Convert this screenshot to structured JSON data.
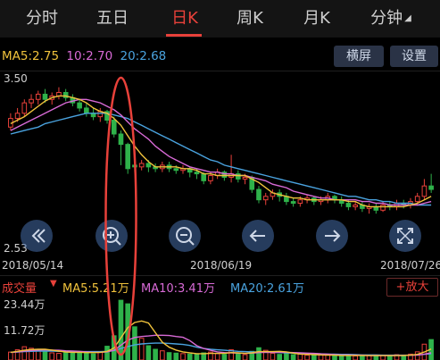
{
  "tabs": [
    {
      "label": "分时"
    },
    {
      "label": "五日"
    },
    {
      "label": "日K"
    },
    {
      "label": "周K"
    },
    {
      "label": "月K"
    },
    {
      "label": "分钟"
    }
  ],
  "active_tab": "日K",
  "ma": {
    "ma5": "MA5:2.75",
    "ma10": "10:2.70",
    "ma20": "20:2.68"
  },
  "buttons": {
    "landscape": "横屏",
    "settings": "设置"
  },
  "price_axis": {
    "max": "3.50",
    "min": "2.53"
  },
  "dates": {
    "start": "2018/05/14",
    "mid": "2018/06/19",
    "end": "2018/07/26"
  },
  "volume": {
    "label": "成交量",
    "ma5": "MA5:5.21万",
    "ma10": "MA10:3.41万",
    "ma20": "MA20:2.61万",
    "add_indicator": "+放大",
    "axis_max": "23.44万",
    "axis_mid": "11.72万"
  },
  "colors": {
    "up": "#e8413a",
    "down": "#2fb24a",
    "ma5": "#f0c23c",
    "ma10": "#d86ad6",
    "ma20": "#4aa3df",
    "highlight": "#e8413a",
    "button_bg": "#2a3346"
  },
  "icons": [
    "rewind-icon",
    "zoom-in-icon",
    "zoom-out-icon",
    "arrow-left-icon",
    "arrow-right-icon",
    "fullscreen-icon"
  ],
  "chart_data": {
    "type": "candlestick",
    "ylim": [
      2.53,
      3.5
    ],
    "candles": [
      [
        3.22,
        3.27,
        3.2,
        3.3
      ],
      [
        3.27,
        3.3,
        3.25,
        3.33
      ],
      [
        3.3,
        3.36,
        3.28,
        3.38
      ],
      [
        3.36,
        3.38,
        3.33,
        3.41
      ],
      [
        3.38,
        3.41,
        3.35,
        3.43
      ],
      [
        3.41,
        3.38,
        3.36,
        3.44
      ],
      [
        3.38,
        3.4,
        3.35,
        3.42
      ],
      [
        3.4,
        3.42,
        3.38,
        3.45
      ],
      [
        3.42,
        3.39,
        3.37,
        3.44
      ],
      [
        3.39,
        3.36,
        3.34,
        3.41
      ],
      [
        3.36,
        3.33,
        3.31,
        3.38
      ],
      [
        3.33,
        3.3,
        3.28,
        3.36
      ],
      [
        3.3,
        3.28,
        3.26,
        3.33
      ],
      [
        3.28,
        3.31,
        3.25,
        3.33
      ],
      [
        3.31,
        3.26,
        3.24,
        3.32
      ],
      [
        3.26,
        3.18,
        3.16,
        3.28
      ],
      [
        3.18,
        3.12,
        3.0,
        3.2
      ],
      [
        3.12,
        2.98,
        2.95,
        3.13
      ],
      [
        3.0,
        2.99,
        2.96,
        3.05
      ],
      [
        2.99,
        3.01,
        2.97,
        3.03
      ],
      [
        3.01,
        2.99,
        2.96,
        3.03
      ],
      [
        2.99,
        2.98,
        2.96,
        3.01
      ],
      [
        2.98,
        3.0,
        2.96,
        3.02
      ],
      [
        3.0,
        2.98,
        2.96,
        3.02
      ],
      [
        2.98,
        2.97,
        2.95,
        3.0
      ],
      [
        2.97,
        2.98,
        2.95,
        3.0
      ],
      [
        2.98,
        2.96,
        2.93,
        2.99
      ],
      [
        2.96,
        2.95,
        2.92,
        2.98
      ],
      [
        2.95,
        2.91,
        2.89,
        2.96
      ],
      [
        2.91,
        2.94,
        2.89,
        2.96
      ],
      [
        2.94,
        2.96,
        2.92,
        2.98
      ],
      [
        2.96,
        2.93,
        2.91,
        2.97
      ],
      [
        2.93,
        2.95,
        2.9,
        3.06
      ],
      [
        2.95,
        2.92,
        2.9,
        2.97
      ],
      [
        2.92,
        2.93,
        2.89,
        2.95
      ],
      [
        2.93,
        2.86,
        2.84,
        2.94
      ],
      [
        2.86,
        2.8,
        2.78,
        2.88
      ],
      [
        2.8,
        2.82,
        2.77,
        2.84
      ],
      [
        2.82,
        2.84,
        2.8,
        2.86
      ],
      [
        2.84,
        2.82,
        2.79,
        2.86
      ],
      [
        2.82,
        2.79,
        2.77,
        2.84
      ],
      [
        2.79,
        2.78,
        2.76,
        2.81
      ],
      [
        2.78,
        2.8,
        2.76,
        2.82
      ],
      [
        2.8,
        2.81,
        2.78,
        2.83
      ],
      [
        2.81,
        2.79,
        2.77,
        2.82
      ],
      [
        2.79,
        2.8,
        2.77,
        2.82
      ],
      [
        2.8,
        2.82,
        2.78,
        2.84
      ],
      [
        2.82,
        2.8,
        2.78,
        2.83
      ],
      [
        2.8,
        2.78,
        2.76,
        2.82
      ],
      [
        2.78,
        2.76,
        2.74,
        2.8
      ],
      [
        2.76,
        2.77,
        2.74,
        2.79
      ],
      [
        2.77,
        2.75,
        2.73,
        2.79
      ],
      [
        2.75,
        2.76,
        2.72,
        2.78
      ],
      [
        2.76,
        2.74,
        2.72,
        2.78
      ],
      [
        2.74,
        2.77,
        2.73,
        2.79
      ],
      [
        2.77,
        2.76,
        2.74,
        2.79
      ],
      [
        2.76,
        2.78,
        2.74,
        2.8
      ],
      [
        2.78,
        2.77,
        2.75,
        2.8
      ],
      [
        2.77,
        2.79,
        2.75,
        2.81
      ],
      [
        2.79,
        2.82,
        2.77,
        2.84
      ],
      [
        2.82,
        2.88,
        2.8,
        2.92
      ],
      [
        2.88,
        2.86,
        2.84,
        2.95
      ]
    ],
    "ma5": [
      3.24,
      3.26,
      3.28,
      3.31,
      3.34,
      3.37,
      3.39,
      3.4,
      3.4,
      3.39,
      3.38,
      3.36,
      3.33,
      3.31,
      3.3,
      3.27,
      3.23,
      3.17,
      3.11,
      3.06,
      3.02,
      2.99,
      2.99,
      2.99,
      2.99,
      2.98,
      2.98,
      2.97,
      2.95,
      2.95,
      2.94,
      2.94,
      2.94,
      2.94,
      2.94,
      2.92,
      2.9,
      2.87,
      2.84,
      2.83,
      2.82,
      2.81,
      2.81,
      2.8,
      2.8,
      2.8,
      2.8,
      2.8,
      2.8,
      2.79,
      2.79,
      2.77,
      2.76,
      2.76,
      2.76,
      2.76,
      2.76,
      2.76,
      2.77,
      2.78,
      2.8,
      2.82
    ],
    "ma10": [
      3.2,
      3.22,
      3.24,
      3.26,
      3.28,
      3.3,
      3.32,
      3.34,
      3.36,
      3.37,
      3.38,
      3.38,
      3.37,
      3.36,
      3.34,
      3.32,
      3.29,
      3.25,
      3.21,
      3.18,
      3.15,
      3.11,
      3.08,
      3.05,
      3.03,
      3.01,
      2.99,
      2.98,
      2.97,
      2.96,
      2.96,
      2.95,
      2.95,
      2.94,
      2.94,
      2.93,
      2.92,
      2.91,
      2.89,
      2.88,
      2.87,
      2.85,
      2.84,
      2.83,
      2.82,
      2.81,
      2.81,
      2.8,
      2.8,
      2.8,
      2.8,
      2.79,
      2.79,
      2.78,
      2.78,
      2.77,
      2.77,
      2.77,
      2.77,
      2.77,
      2.78,
      2.79
    ],
    "ma20": [
      3.18,
      3.19,
      3.2,
      3.21,
      3.22,
      3.24,
      3.25,
      3.26,
      3.27,
      3.28,
      3.29,
      3.3,
      3.3,
      3.3,
      3.3,
      3.29,
      3.28,
      3.27,
      3.25,
      3.23,
      3.21,
      3.19,
      3.17,
      3.15,
      3.13,
      3.11,
      3.09,
      3.07,
      3.05,
      3.03,
      3.02,
      3.0,
      2.99,
      2.98,
      2.97,
      2.96,
      2.95,
      2.94,
      2.93,
      2.92,
      2.91,
      2.9,
      2.89,
      2.88,
      2.87,
      2.86,
      2.85,
      2.84,
      2.83,
      2.82,
      2.82,
      2.81,
      2.8,
      2.8,
      2.79,
      2.79,
      2.78,
      2.78,
      2.78,
      2.77,
      2.77,
      2.77
    ],
    "volume": [
      3.1,
      4.0,
      5.2,
      4.6,
      3.9,
      3.2,
      2.8,
      2.6,
      2.9,
      3.5,
      3.0,
      2.7,
      2.4,
      3.2,
      5.4,
      9.5,
      23.4,
      22.0,
      13.0,
      8.5,
      5.6,
      4.2,
      3.6,
      2.9,
      2.7,
      2.5,
      2.3,
      2.2,
      2.8,
      3.1,
      2.5,
      2.2,
      4.0,
      2.3,
      2.1,
      3.4,
      4.8,
      3.8,
      2.6,
      2.2,
      2.5,
      2.1,
      2.3,
      1.9,
      1.8,
      1.9,
      2.0,
      1.8,
      1.7,
      1.9,
      1.6,
      1.8,
      1.7,
      1.5,
      1.8,
      1.6,
      2.1,
      1.9,
      2.3,
      3.2,
      6.2,
      8.0
    ],
    "vol_ma5": [
      3.0,
      3.4,
      3.8,
      4.1,
      4.2,
      4.2,
      3.9,
      3.5,
      3.1,
      3.0,
      3.0,
      2.9,
      2.9,
      3.0,
      3.4,
      4.7,
      8.7,
      12.7,
      14.7,
      15.3,
      14.5,
      10.7,
      7.0,
      5.0,
      3.9,
      3.2,
      2.8,
      2.5,
      2.5,
      2.6,
      2.6,
      2.6,
      2.9,
      2.8,
      2.6,
      2.8,
      3.3,
      3.3,
      3.3,
      3.4,
      3.2,
      2.7,
      2.3,
      2.2,
      2.1,
      2.0,
      1.9,
      1.9,
      1.8,
      1.8,
      1.8,
      1.8,
      1.7,
      1.7,
      1.7,
      1.7,
      1.7,
      1.8,
      1.9,
      2.2,
      3.1,
      4.3
    ],
    "vol_ma10": [
      3.0,
      3.2,
      3.5,
      3.7,
      3.9,
      4.0,
      3.9,
      3.8,
      3.6,
      3.5,
      3.4,
      3.2,
      3.0,
      3.0,
      3.2,
      3.8,
      5.8,
      7.8,
      8.8,
      9.2,
      9.4,
      9.7,
      9.7,
      9.6,
      9.2,
      8.9,
      7.6,
      5.6,
      4.5,
      3.8,
      3.2,
      2.9,
      2.8,
      2.7,
      2.6,
      2.7,
      2.9,
      3.0,
      3.0,
      3.0,
      3.0,
      2.9,
      2.8,
      2.7,
      2.6,
      2.4,
      2.3,
      2.1,
      2.0,
      2.0,
      1.9,
      1.9,
      1.8,
      1.8,
      1.8,
      1.8,
      1.8,
      1.8,
      1.9,
      1.9,
      2.3,
      2.8
    ],
    "vol_ma20": [
      3.0,
      3.1,
      3.3,
      3.4,
      3.5,
      3.5,
      3.5,
      3.4,
      3.4,
      3.3,
      3.3,
      3.3,
      3.3,
      3.3,
      3.4,
      3.7,
      4.5,
      5.3,
      5.9,
      6.3,
      6.5,
      6.6,
      6.6,
      6.5,
      6.3,
      6.1,
      5.7,
      5.0,
      4.5,
      4.2,
      4.0,
      3.8,
      3.6,
      3.4,
      3.3,
      3.2,
      3.1,
      3.0,
      3.0,
      2.9,
      2.8,
      2.7,
      2.6,
      2.5,
      2.5,
      2.4,
      2.3,
      2.3,
      2.2,
      2.2,
      2.1,
      2.0,
      2.0,
      2.0,
      1.9,
      1.9,
      1.9,
      1.9,
      1.9,
      2.0,
      2.2,
      2.4
    ],
    "vol_ylim": [
      0,
      23.44
    ],
    "highlight_index": 16
  }
}
